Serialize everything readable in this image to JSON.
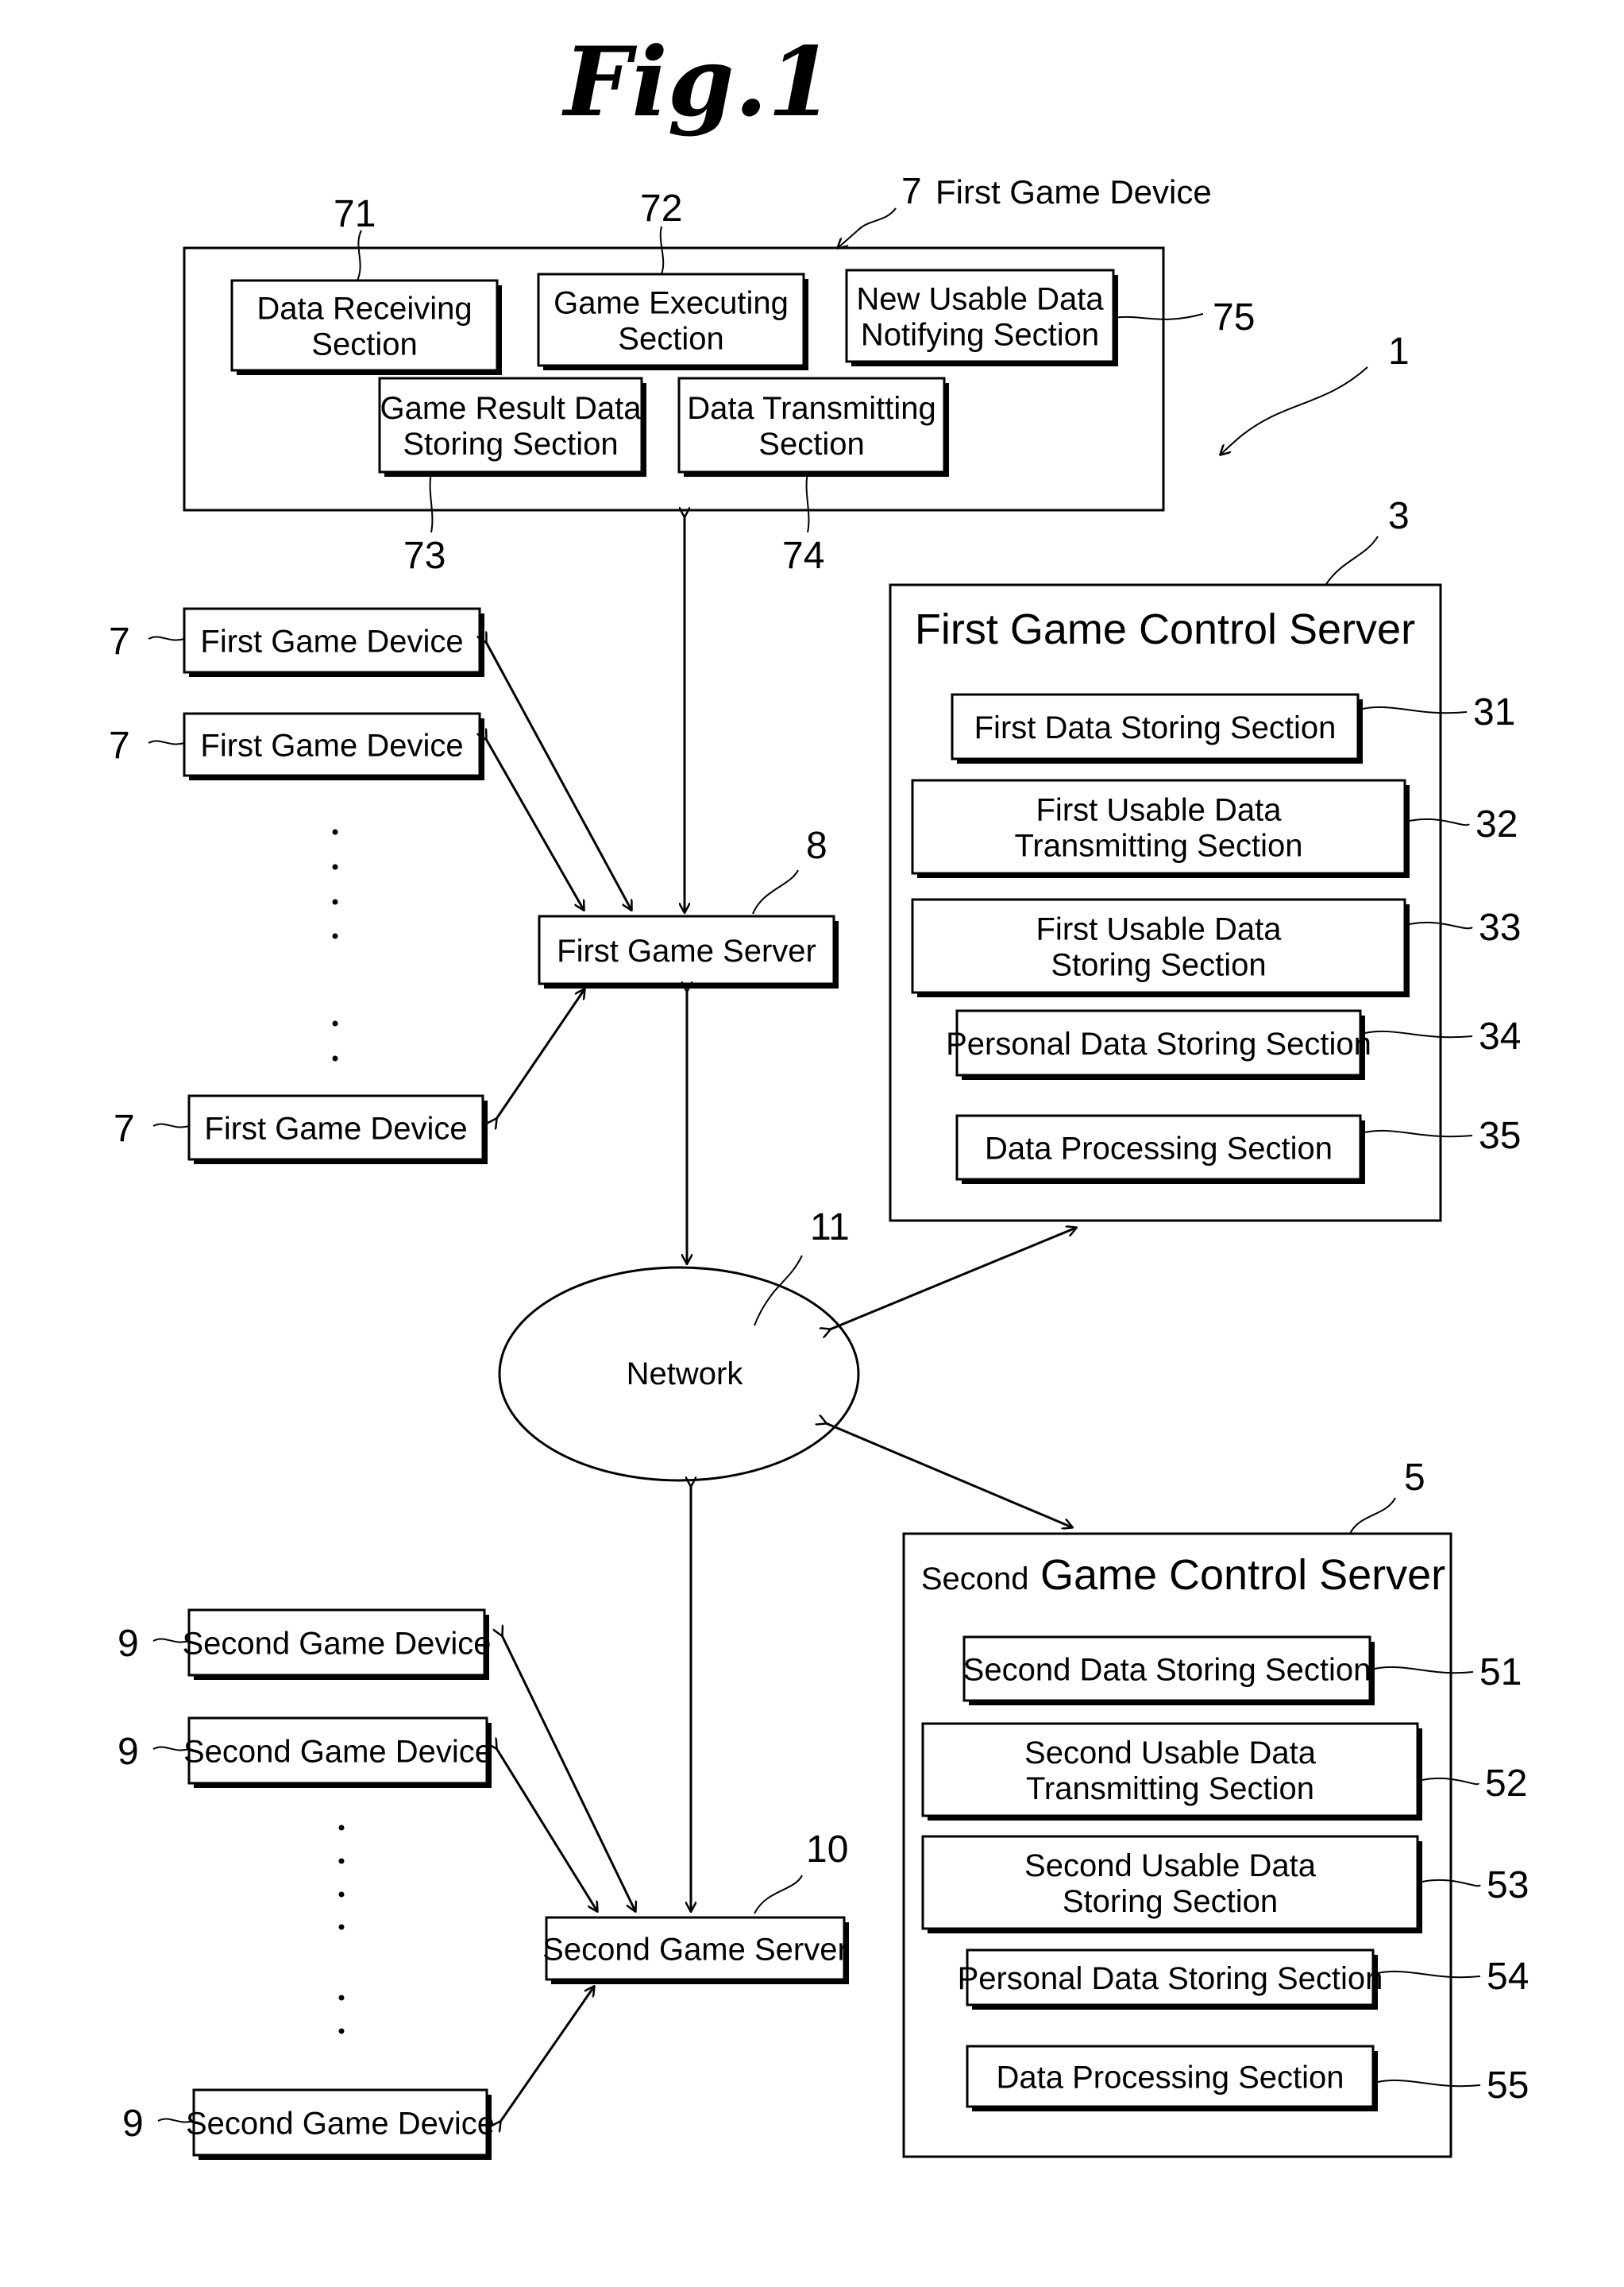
{
  "figure": {
    "title": "Fig.1",
    "system_ref": "1"
  },
  "first_game_device_detail": {
    "ref": "7",
    "label": "First Game Device",
    "sections": [
      {
        "ref": "71",
        "lines": [
          "Data Receiving",
          "Section"
        ]
      },
      {
        "ref": "72",
        "lines": [
          "Game Executing",
          "Section"
        ]
      },
      {
        "ref": "75",
        "lines": [
          "New Usable Data",
          "Notifying Section"
        ]
      },
      {
        "ref": "73",
        "lines": [
          "Game Result Data",
          "Storing Section"
        ]
      },
      {
        "ref": "74",
        "lines": [
          "Data Transmitting",
          "Section"
        ]
      }
    ]
  },
  "first_game_devices": [
    {
      "ref": "7",
      "label": "First Game Device"
    },
    {
      "ref": "7",
      "label": "First Game Device"
    },
    {
      "ref": "7",
      "label": "First Game Device"
    }
  ],
  "first_game_server": {
    "ref": "8",
    "label": "First Game Server"
  },
  "first_game_control_server": {
    "ref": "3",
    "title": "First Game Control Server",
    "sections": [
      {
        "ref": "31",
        "lines": [
          "First Data Storing Section"
        ]
      },
      {
        "ref": "32",
        "lines": [
          "First Usable Data",
          "Transmitting Section"
        ]
      },
      {
        "ref": "33",
        "lines": [
          "First Usable Data",
          "Storing Section"
        ]
      },
      {
        "ref": "34",
        "lines": [
          "Personal Data Storing Section"
        ]
      },
      {
        "ref": "35",
        "lines": [
          "Data Processing Section"
        ]
      }
    ]
  },
  "network": {
    "ref": "11",
    "label": "Network"
  },
  "second_game_devices": [
    {
      "ref": "9",
      "label": "Second Game Device"
    },
    {
      "ref": "9",
      "label": "Second Game Device"
    },
    {
      "ref": "9",
      "label": "Second Game Device"
    }
  ],
  "second_game_server": {
    "ref": "10",
    "label": "Second Game Server"
  },
  "second_game_control_server": {
    "ref": "5",
    "title_prefix": "Second",
    "title": "Game Control Server",
    "sections": [
      {
        "ref": "51",
        "lines": [
          "Second Data Storing Section"
        ]
      },
      {
        "ref": "52",
        "lines": [
          "Second Usable Data",
          "Transmitting Section"
        ]
      },
      {
        "ref": "53",
        "lines": [
          "Second Usable Data",
          "Storing Section"
        ]
      },
      {
        "ref": "54",
        "lines": [
          "Personal Data Storing Section"
        ]
      },
      {
        "ref": "55",
        "lines": [
          "Data Processing Section"
        ]
      }
    ]
  }
}
